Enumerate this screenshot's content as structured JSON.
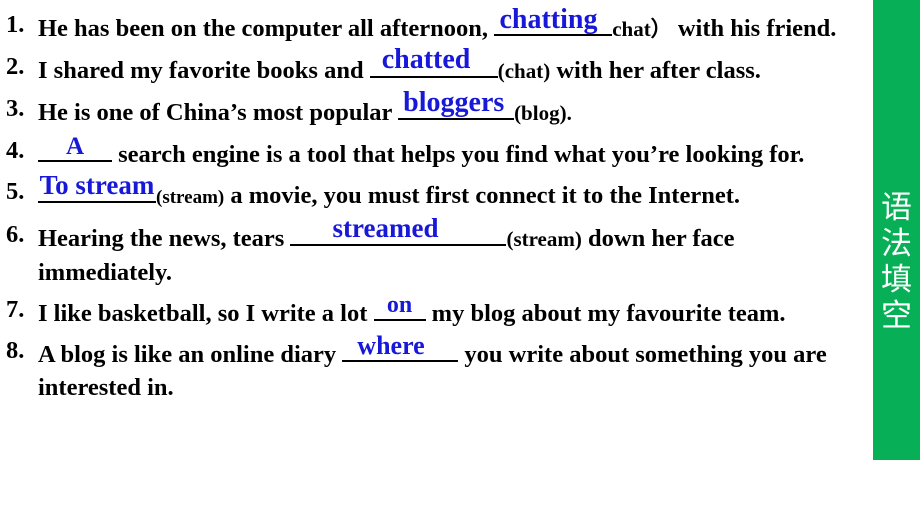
{
  "slide": {
    "background_color": "#ffffff",
    "answer_color": "#1818d8",
    "text_color": "#000000"
  },
  "side_banner": {
    "label": "语\n法\n填\n空",
    "background_color": "#07b056",
    "text_color": "#ffffff"
  },
  "questions": [
    {
      "number": "1.",
      "before": "He has been on the computer all afternoon, ",
      "answer": "chatting",
      "cue": "chat）",
      "after": " with his friend."
    },
    {
      "number": "2.",
      "before": "I shared my favorite books and ",
      "answer": "chatted",
      "cue": "(chat)",
      "after": " with her after class."
    },
    {
      "number": "3.",
      "before": " He is one of China’s most popular ",
      "answer": "bloggers",
      "cue": "(blog).",
      "after": ""
    },
    {
      "number": "4.",
      "before": "  ",
      "answer": "A",
      "cue": "",
      "after": " search engine is a tool that helps you find what you’re looking for."
    },
    {
      "number": "5.",
      "before": "",
      "answer": "To stream",
      "cue": "(stream)",
      "after": " a movie, you must first connect it to the Internet."
    },
    {
      "number": "6.",
      "before": " Hearing the news, tears ",
      "answer": "streamed",
      "cue": "(stream)",
      "after": " down her face immediately."
    },
    {
      "number": "7.",
      "before": " I like basketball, so I write a lot ",
      "answer": "on",
      "cue": "",
      "after": " my blog about my favourite team."
    },
    {
      "number": "8.",
      "before": " A blog is like an online diary ",
      "answer": "where",
      "cue": "",
      "after": " you write about something you are interested in."
    }
  ]
}
